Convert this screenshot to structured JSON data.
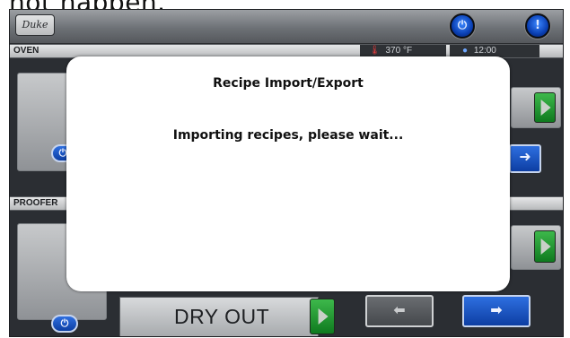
{
  "caption": {
    "text": "not happen."
  },
  "header": {
    "logo_text": "Duke",
    "power_icon": "power-icon",
    "alert_icon": "alert-icon"
  },
  "oven": {
    "label": "OVEN",
    "temperature_icon": "thermometer-icon",
    "temperature": "370 °F",
    "clock_icon": "clock-icon",
    "time": "12:00"
  },
  "proofer": {
    "label": "PROOFER",
    "program_label": "DRY OUT"
  },
  "modal": {
    "title": "Recipe Import/Export",
    "message": "Importing recipes, please wait..."
  },
  "colors": {
    "accent_blue": "#1f5fd6",
    "go_green": "#1f9a33",
    "modal_bg": "#ffffff",
    "chrome_gray": "#8f9296"
  }
}
